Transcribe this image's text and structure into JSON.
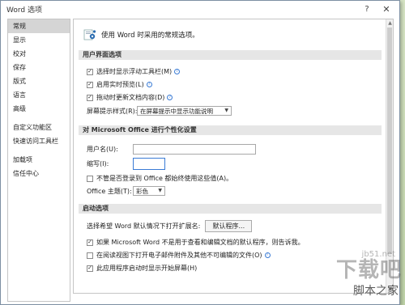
{
  "window": {
    "title": "Word 选项",
    "help_glyph": "?",
    "close_glyph": "✕"
  },
  "sidebar": {
    "items": [
      {
        "label": "常规",
        "active": true
      },
      {
        "label": "显示"
      },
      {
        "label": "校对"
      },
      {
        "label": "保存"
      },
      {
        "label": "版式"
      },
      {
        "label": "语言"
      },
      {
        "label": "高级"
      },
      {
        "label": "自定义功能区"
      },
      {
        "label": "快速访问工具栏"
      },
      {
        "label": "加载项"
      },
      {
        "label": "信任中心"
      }
    ]
  },
  "header": {
    "text": "使用 Word 时采用的常规选项。",
    "icon": "settings-icon"
  },
  "sections": {
    "ui": {
      "title": "用户界面选项",
      "mini_toolbar": {
        "label": "选择时显示浮动工具栏(M)",
        "checked": true
      },
      "live_preview": {
        "label": "启用实时预览(L)",
        "checked": true
      },
      "update_on_drag": {
        "label": "拖动时更新文档内容(D)",
        "checked": true
      },
      "screentip_label": "屏幕提示样式(R):",
      "screentip_value": "在屏幕提示中显示功能说明"
    },
    "personalize": {
      "title": "对 Microsoft Office 进行个性化设置",
      "username_label": "用户名(U):",
      "username_value": "",
      "initials_label": "缩写(I):",
      "initials_value": "",
      "always_use": {
        "label": "不管是否登录到 Office 都始终使用这些值(A)。",
        "checked": false
      },
      "theme_label": "Office 主题(T):",
      "theme_value": "彩色"
    },
    "startup": {
      "title": "启动选项",
      "default_programs_label": "选择希望 Word 默认情况下打开扩展名:",
      "default_programs_button": "默认程序...",
      "tell_me": {
        "label": "如果 Microsoft Word 不是用于查看和编辑文档的默认程序，则告诉我。",
        "checked": true
      },
      "reading_view": {
        "label": "在阅读视图下打开电子邮件附件及其他不可编辑的文件(O)",
        "checked": false
      },
      "start_screen": {
        "label": "此应用程序启动时显示开始屏幕(H)",
        "checked": true
      }
    }
  },
  "icons": {
    "info": "i",
    "check": "✓",
    "dropdown": "▼",
    "scroll_up": "▲",
    "scroll_down": "▼"
  },
  "watermark": {
    "url": "jb51.net",
    "big": "下载吧",
    "small": "脚本之家"
  },
  "colors": {
    "accent": "#3a7bd5",
    "section_bg": "#e6e6e6",
    "active_nav": "#d5d5d5",
    "icon_blue": "#2b6cb0"
  }
}
